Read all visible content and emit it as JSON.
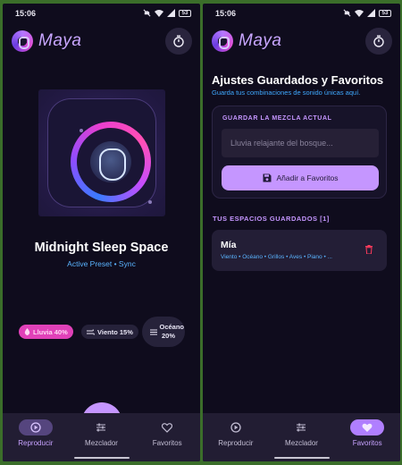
{
  "status": {
    "time": "15:06",
    "battery": "53"
  },
  "app": {
    "name": "Maya"
  },
  "player": {
    "title": "Midnight Sleep Space",
    "subtitle": "Active Preset • Sync",
    "chips": [
      {
        "label": "Lluvia 40%",
        "icon": "drop-icon"
      },
      {
        "label": "Viento 15%",
        "icon": "wind-icon"
      },
      {
        "label": "Océano 20%",
        "icon": "waves-icon"
      }
    ]
  },
  "nav": {
    "items": [
      {
        "label": "Reproducir",
        "icon": "play-icon"
      },
      {
        "label": "Mezclador",
        "icon": "sliders-icon"
      },
      {
        "label": "Favoritos",
        "icon": "heart-icon"
      }
    ]
  },
  "saved": {
    "title": "Ajustes Guardados y Favoritos",
    "subtitle": "Guarda tus combinaciones de sonido únicas aquí.",
    "save_heading": "GUARDAR LA MEZCLA ACTUAL",
    "input_placeholder": "Lluvia relajante del bosque...",
    "add_button": "Añadir a Favoritos",
    "spaces_heading": "TUS ESPACIOS GUARDADOS [1]",
    "spaces": [
      {
        "name": "Mía",
        "sounds": "Viento • Océano • Grillos • Aves • Piano • ..."
      }
    ]
  },
  "colors": {
    "background": "#0f0c1d",
    "accent": "#c596ff",
    "link": "#5ab4ff",
    "chip_active": "#e041b8",
    "delete": "#ff3b5c"
  }
}
